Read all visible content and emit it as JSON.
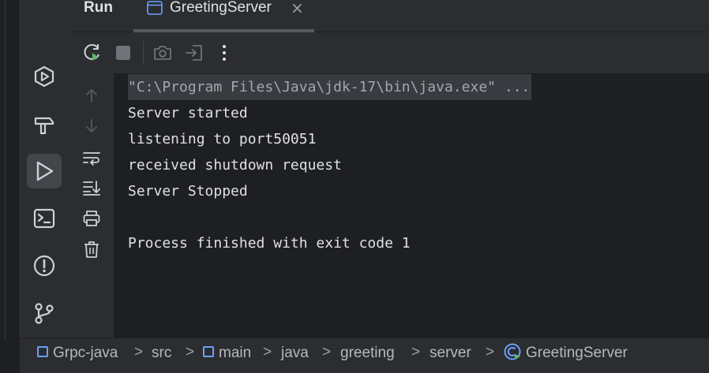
{
  "header": {
    "title": "Run",
    "tab": {
      "label": "GreetingServer",
      "close_glyph": "×"
    }
  },
  "toolbar": {
    "buttons": [
      "rerun-icon",
      "stop-icon",
      "camera-icon",
      "exit-icon",
      "more-icon"
    ]
  },
  "console": {
    "lines": [
      "\"C:\\Program Files\\Java\\jdk-17\\bin\\java.exe\" ...",
      "Server started",
      "listening to port50051",
      "received shutdown request",
      "Server Stopped",
      "",
      "Process finished with exit code 1"
    ]
  },
  "breadcrumb": {
    "items": [
      "Grpc-java",
      "src",
      "main",
      "java",
      "greeting",
      "server",
      "GreetingServer"
    ],
    "separator": ">"
  },
  "colors": {
    "background": "#1e1f22",
    "panel": "#2b2d30",
    "text": "#dfe1e5",
    "accent_blue": "#6e9eff",
    "run_green": "#5fb865"
  }
}
